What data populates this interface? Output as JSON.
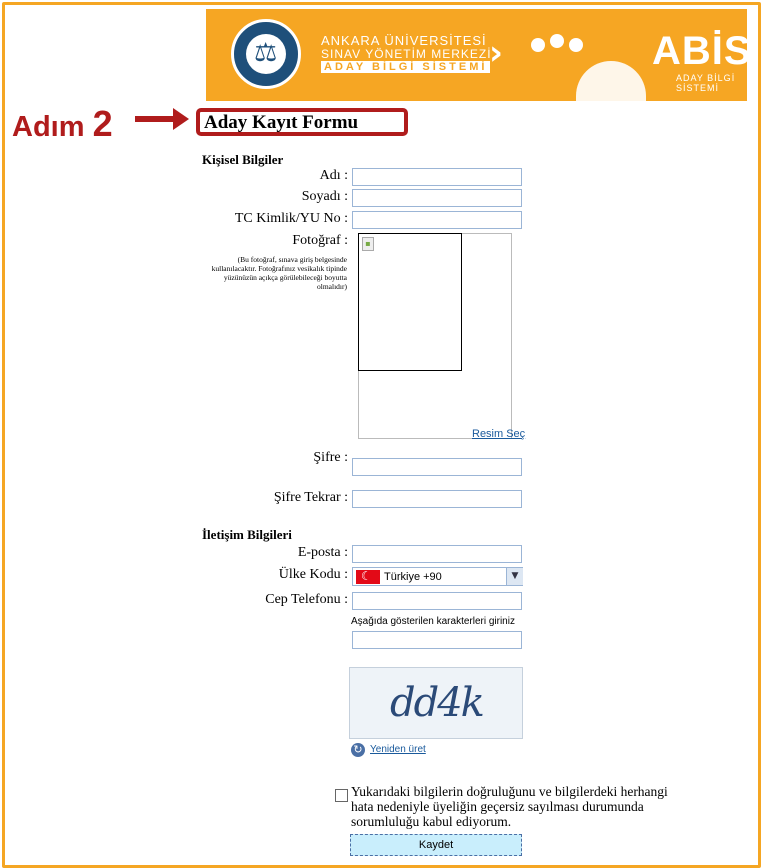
{
  "banner": {
    "line1": "ANKARA ÜNİVERSİTESİ",
    "line2": "SINAV YÖNETİM MERKEZİ",
    "line3": "ADAY BİLGİ SİSTEMİ",
    "logo": "ABİS",
    "logo_sub": "ADAY BİLGİ SİSTEMİ"
  },
  "step": {
    "label": "Adım",
    "number": "2"
  },
  "form": {
    "title": "Aday Kayıt Formu",
    "personal": {
      "heading": "Kişisel Bilgiler",
      "name_label": "Adı :",
      "surname_label": "Soyadı :",
      "tc_label": "TC Kimlik/YU No :",
      "photo_label": "Fotoğraf :",
      "photo_note": "(Bu fotoğraf, sınava giriş belgesinde kullanılacaktır. Fotoğrafınız vesikalık tipinde yüzünüzün açıkça görülebileceği boyutta olmalıdır)",
      "photo_button": "Resim Seç",
      "password_label": "Şifre :",
      "password_repeat_label": "Şifre Tekrar :"
    },
    "contact": {
      "heading": "İletişim Bilgileri",
      "email_label": "E-posta :",
      "country_label": "Ülke Kodu :",
      "country_value": "Türkiye +90",
      "phone_label": "Cep Telefonu :",
      "captcha_label": "Aşağıda gösterilen karakterleri giriniz",
      "captcha_text": "dd4k",
      "regenerate": "Yeniden üret"
    },
    "agreement": "Yukarıdaki bilgilerin doğruluğunu ve bilgilerdeki herhangi hata nedeniyle üyeliğin geçersiz sayılması durumunda sorumluluğu kabul ediyorum.",
    "save_label": "Kaydet"
  }
}
